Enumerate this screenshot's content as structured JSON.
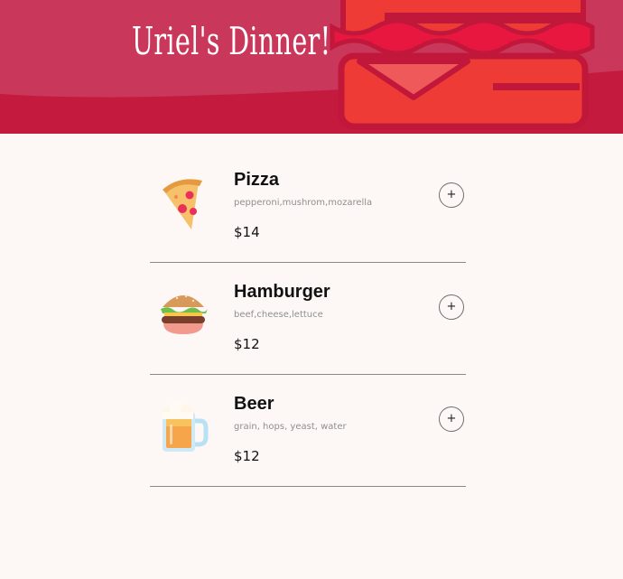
{
  "header": {
    "title": "Uriel's Dinner!",
    "banner_icon": "hamburger-icon",
    "background": "#c41a3e"
  },
  "menu": {
    "items": [
      {
        "name": "Pizza",
        "ingredients": "pepperoni,mushrom,mozarella",
        "price": "$14",
        "icon": "pizza-icon",
        "add_label": "+"
      },
      {
        "name": "Hamburger",
        "ingredients": "beef,cheese,lettuce",
        "price": "$12",
        "icon": "hamburger-icon",
        "add_label": "+"
      },
      {
        "name": "Beer",
        "ingredients": "grain, hops, yeast, water",
        "price": "$12",
        "icon": "beer-icon",
        "add_label": "+"
      }
    ]
  }
}
